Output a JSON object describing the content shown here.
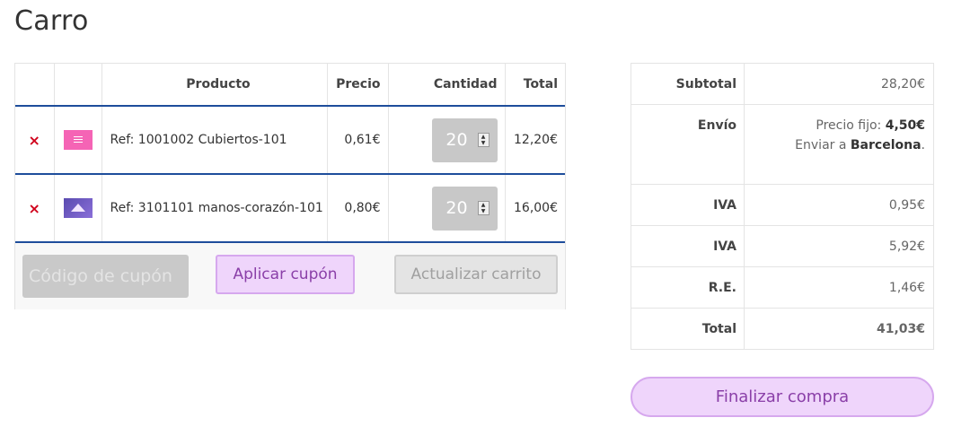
{
  "page": {
    "title": "Carro"
  },
  "cart": {
    "headers": {
      "product": "Producto",
      "price": "Precio",
      "quantity": "Cantidad",
      "total": "Total"
    },
    "items": [
      {
        "remove": "×",
        "thumb_icon": "product-thumbnail-cutlery",
        "name": "Ref: 1001002 Cubiertos-101",
        "price": "0,61€",
        "quantity": "20",
        "total": "12,20€"
      },
      {
        "remove": "×",
        "thumb_icon": "product-thumbnail-hands-heart",
        "name": "Ref: 3101101 manos-corazón-101",
        "price": "0,80€",
        "quantity": "20",
        "total": "16,00€"
      }
    ],
    "coupon": {
      "placeholder": "Código de cupón"
    },
    "apply_label": "Aplicar cupón",
    "update_label": "Actualizar carrito"
  },
  "totals": {
    "subtotal_label": "Subtotal",
    "subtotal": "28,20€",
    "shipping_label": "Envío",
    "shipping_prefix": "Precio fijo:",
    "shipping_amount": "4,50€",
    "ship_to_prefix": "Enviar a",
    "ship_to_city": "Barcelona",
    "ship_to_suffix": ".",
    "taxes": [
      {
        "label": "IVA",
        "value": "0,95€"
      },
      {
        "label": "IVA",
        "value": "5,92€"
      },
      {
        "label": "R.E.",
        "value": "1,46€"
      }
    ],
    "total_label": "Total",
    "total": "41,03€"
  },
  "checkout_label": "Finalizar compra",
  "colors": {
    "accent_border": "#1e4d9b",
    "remove": "#d0021b",
    "button_bg": "#efd5fb",
    "button_text": "#8a3fa8"
  }
}
